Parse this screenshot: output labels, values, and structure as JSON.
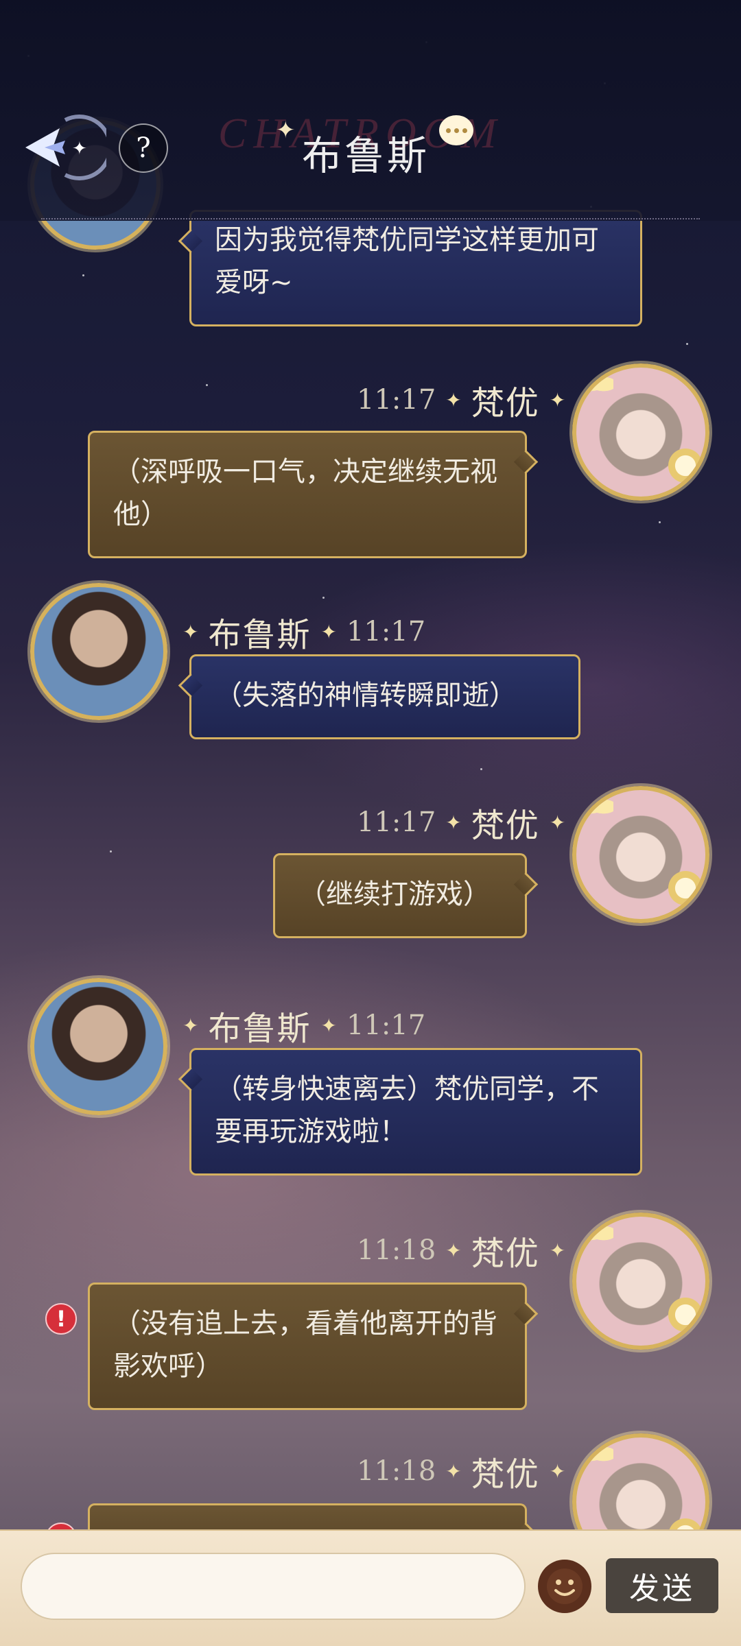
{
  "header": {
    "watermark": "CHATROOM",
    "title": "布鲁斯",
    "help_label": "?"
  },
  "messages": [
    {
      "sender": "",
      "time": "",
      "text": "因为我觉得梵优同学这样更加可爱呀~"
    },
    {
      "sender": "梵优",
      "time": "11:17",
      "text": "（深呼吸一口气，决定继续无视他）"
    },
    {
      "sender": "布鲁斯",
      "time": "11:17",
      "text": "（失落的神情转瞬即逝）"
    },
    {
      "sender": "梵优",
      "time": "11:17",
      "text": "（继续打游戏）"
    },
    {
      "sender": "布鲁斯",
      "time": "11:17",
      "text": "（转身快速离去）梵优同学，不要再玩游戏啦！"
    },
    {
      "sender": "梵优",
      "time": "11:18",
      "text": "（没有追上去，看着他离开的背影欢呼）"
    },
    {
      "sender": "梵优",
      "time": "11:18",
      "text": ""
    }
  ],
  "input": {
    "placeholder": "",
    "send_label": "发送"
  },
  "colors": {
    "bubble_blue": "#2a3366",
    "bubble_gold": "#6b5533",
    "frame_gold": "#d5b160",
    "error_red": "#d62f3a"
  }
}
